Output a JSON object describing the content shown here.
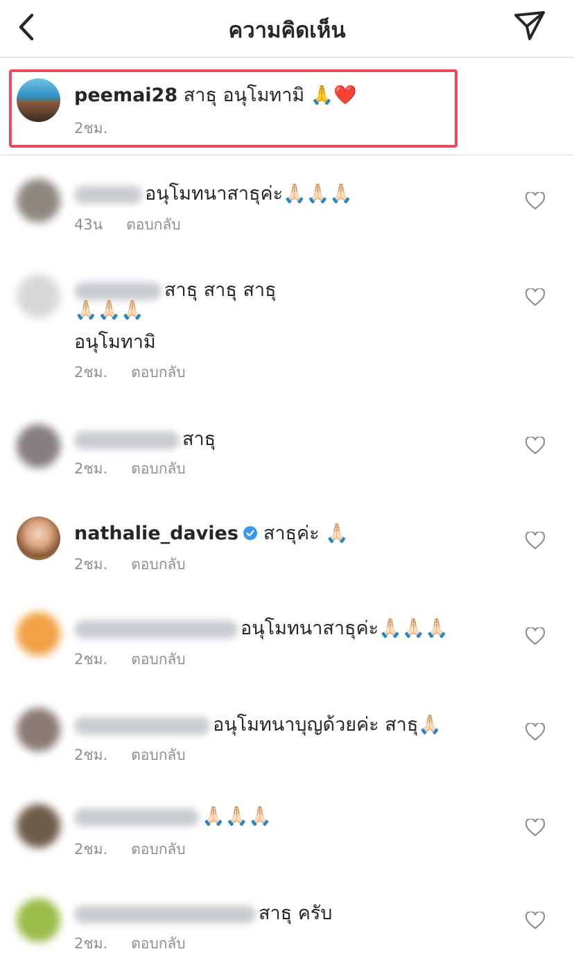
{
  "header": {
    "title": "ความคิดเห็น"
  },
  "caption": {
    "username": "peemai28",
    "text": "สาธุ อนุโมทามิ 🙏❤️",
    "time": "2ชม."
  },
  "comments": [
    {
      "text": "อนุโมทนาสาธุค่ะ🙏🏻🙏🏻🙏🏻",
      "time": "43น",
      "reply": "ตอบกลับ"
    },
    {
      "text": "สาธุ สาธุ สาธุ",
      "text2": "🙏🏻🙏🏻🙏🏻",
      "text3": "อนุโมทามิ",
      "time": "2ชม.",
      "reply": "ตอบกลับ"
    },
    {
      "text": "สาธุ",
      "time": "2ชม.",
      "reply": "ตอบกลับ"
    },
    {
      "username": "nathalie_davies",
      "verified": true,
      "text": "สาธุค่ะ 🙏🏻",
      "time": "2ชม.",
      "reply": "ตอบกลับ"
    },
    {
      "text": "อนุโมทนาสาธุค่ะ🙏🏻🙏🏻🙏🏻",
      "time": "2ชม.",
      "reply": "ตอบกลับ"
    },
    {
      "text": "อนุโมทนาบุญด้วยค่ะ สาธุ🙏🏻",
      "time": "2ชม.",
      "reply": "ตอบกลับ"
    },
    {
      "text": "🙏🏻🙏🏻🙏🏻",
      "time": "2ชม.",
      "reply": "ตอบกลับ"
    },
    {
      "text": "สาธุ ครับ",
      "time": "2ชม.",
      "reply": "ตอบกลับ"
    }
  ]
}
